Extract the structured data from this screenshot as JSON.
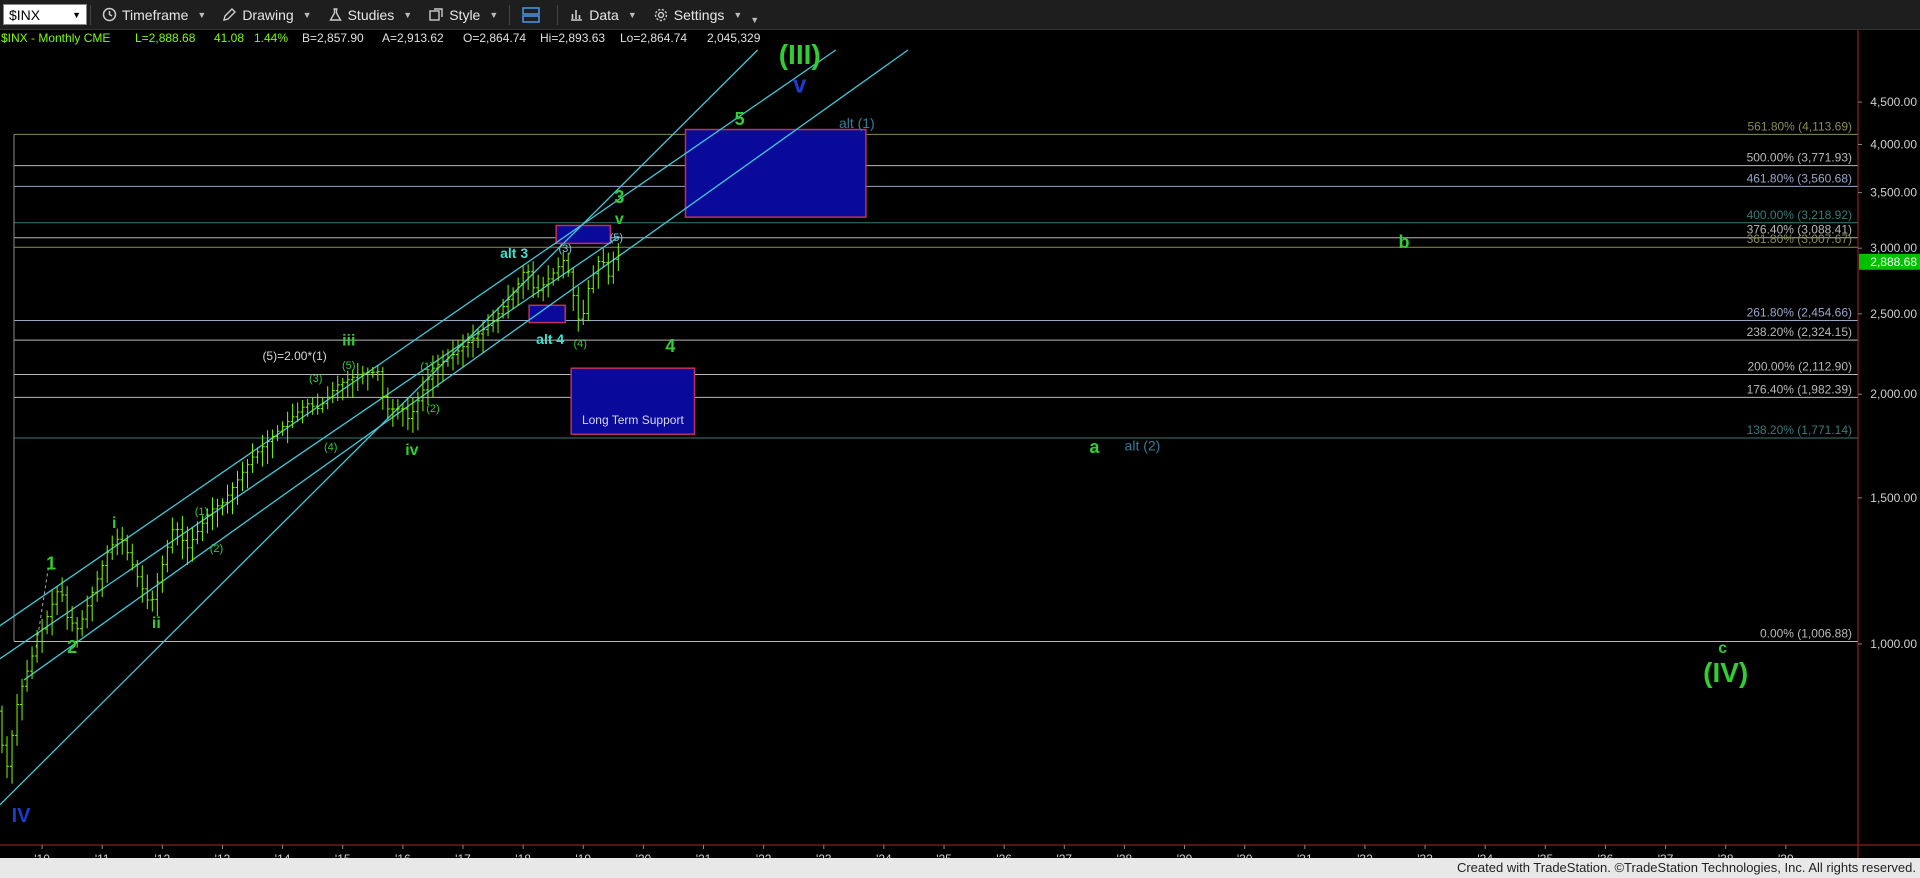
{
  "toolbar": {
    "symbol": "$INX",
    "timeframe_label": "Timeframe",
    "drawing_label": "Drawing",
    "studies_label": "Studies",
    "style_label": "Style",
    "data_label": "Data",
    "settings_label": "Settings"
  },
  "header": {
    "symbol_info": "$INX - Monthly  CME",
    "last": "L=2,888.68",
    "change": "41.08",
    "change_pct": "1.44%",
    "bid": "B=2,857.90",
    "ask": "A=2,913.62",
    "open": "O=2,864.74",
    "high": "Hi=2,893.63",
    "low": "Lo=2,864.74",
    "volume": "2,045,329"
  },
  "footer_text": "Created with TradeStation. ©TradeStation Technologies, Inc. All rights reserved.",
  "colors": {
    "background": "#000000",
    "price_bars": "#7CFC00",
    "wave_green": "#32CD32",
    "wave_cyan": "#40E0D0",
    "wave_blue": "#1E3AD0",
    "channel": "#40C8D8",
    "box_fill": "#0A0A9A",
    "box_border": "#C0305A",
    "last_price_tag": "#00C000"
  },
  "chart_data": {
    "type": "line",
    "scale": "log",
    "x_start": 2009.3,
    "x_end": 2040.2,
    "ylim": [
      600,
      5200
    ],
    "y_ticks": [
      {
        "value": 1000,
        "label": "1,000.00"
      },
      {
        "value": 1500,
        "label": "1,500.00"
      },
      {
        "value": 2000,
        "label": "2,000.00"
      },
      {
        "value": 2500,
        "label": "2,500.00"
      },
      {
        "value": 3000,
        "label": "3,000.00"
      },
      {
        "value": 3500,
        "label": "3,500.00"
      },
      {
        "value": 4000,
        "label": "4,000.00"
      },
      {
        "value": 4500,
        "label": "4,500.00"
      }
    ],
    "x_ticks": [
      {
        "value": 2010,
        "label": "'10"
      },
      {
        "value": 2011,
        "label": "'11"
      },
      {
        "value": 2012,
        "label": "'12"
      },
      {
        "value": 2013,
        "label": "'13"
      },
      {
        "value": 2014,
        "label": "'14"
      },
      {
        "value": 2015,
        "label": "'15"
      },
      {
        "value": 2016,
        "label": "'16"
      },
      {
        "value": 2017,
        "label": "'17"
      },
      {
        "value": 2018,
        "label": "'18"
      },
      {
        "value": 2019,
        "label": "'19"
      },
      {
        "value": 2020,
        "label": "'20"
      },
      {
        "value": 2021,
        "label": "'21"
      },
      {
        "value": 2022,
        "label": "'22"
      },
      {
        "value": 2023,
        "label": "'23"
      },
      {
        "value": 2024,
        "label": "'24"
      },
      {
        "value": 2025,
        "label": "'25"
      },
      {
        "value": 2026,
        "label": "'26"
      },
      {
        "value": 2027,
        "label": "'27"
      },
      {
        "value": 2028,
        "label": "'28"
      },
      {
        "value": 2029,
        "label": "'29"
      },
      {
        "value": 2030,
        "label": "'30"
      },
      {
        "value": 2031,
        "label": "'31"
      },
      {
        "value": 2032,
        "label": "'32"
      },
      {
        "value": 2033,
        "label": "'33"
      },
      {
        "value": 2034,
        "label": "'34"
      },
      {
        "value": 2035,
        "label": "'35"
      },
      {
        "value": 2036,
        "label": "'36"
      },
      {
        "value": 2037,
        "label": "'37"
      },
      {
        "value": 2038,
        "label": "'38"
      },
      {
        "value": 2039,
        "label": "'39"
      }
    ],
    "last_price": {
      "value": 2888.68,
      "label": "2,888.68"
    },
    "price_path": [
      [
        2009.25,
        830
      ],
      [
        2009.4,
        700
      ],
      [
        2009.6,
        860
      ],
      [
        2009.9,
        1000
      ],
      [
        2010.3,
        1180
      ],
      [
        2010.4,
        1080
      ],
      [
        2010.6,
        1040
      ],
      [
        2011.1,
        1300
      ],
      [
        2011.3,
        1350
      ],
      [
        2011.7,
        1150
      ],
      [
        2011.8,
        1110
      ],
      [
        2012.2,
        1400
      ],
      [
        2012.4,
        1300
      ],
      [
        2012.8,
        1450
      ],
      [
        2013.0,
        1480
      ],
      [
        2013.5,
        1680
      ],
      [
        2013.9,
        1800
      ],
      [
        2014.4,
        1950
      ],
      [
        2014.6,
        1920
      ],
      [
        2014.9,
        2050
      ],
      [
        2015.3,
        2120
      ],
      [
        2015.6,
        2130
      ],
      [
        2015.7,
        1920
      ],
      [
        2016.0,
        1920
      ],
      [
        2016.1,
        1860
      ],
      [
        2016.5,
        2150
      ],
      [
        2016.9,
        2250
      ],
      [
        2017.5,
        2450
      ],
      [
        2017.9,
        2700
      ],
      [
        2018.05,
        2860
      ],
      [
        2018.2,
        2640
      ],
      [
        2018.5,
        2800
      ],
      [
        2018.7,
        2920
      ],
      [
        2018.95,
        2400
      ],
      [
        2019.1,
        2720
      ],
      [
        2019.3,
        2950
      ],
      [
        2019.4,
        2750
      ],
      [
        2019.55,
        2990
      ],
      [
        2019.62,
        2890
      ]
    ],
    "fib_levels": [
      {
        "value": 4113.69,
        "label": "561.80% (4,113.69)",
        "color": "#8C8C50"
      },
      {
        "value": 3771.93,
        "label": "500.00% (3,771.93)",
        "color": "#B8B8B8"
      },
      {
        "value": 3560.68,
        "label": "461.80% (3,560.68)",
        "color": "#9AA6C8"
      },
      {
        "value": 3218.92,
        "label": "400.00% (3,218.92)",
        "color": "#3A7A7A"
      },
      {
        "value": 3088.41,
        "label": "376.40% (3,088.41)",
        "color": "#B8B8B8"
      },
      {
        "value": 3007.67,
        "label": "361.80% (3,007.67)",
        "color": "#8C8C50"
      },
      {
        "value": 2454.66,
        "label": "261.80% (2,454.66)",
        "color": "#9AA6C8"
      },
      {
        "value": 2324.15,
        "label": "238.20% (2,324.15)",
        "color": "#B8B8B8"
      },
      {
        "value": 2112.9,
        "label": "200.00% (2,112.90)",
        "color": "#B8B8B8"
      },
      {
        "value": 1982.39,
        "label": "176.40% (1,982.39)",
        "color": "#B8B8B8"
      },
      {
        "value": 1771.14,
        "label": "138.20% (1,771.14)",
        "color": "#3A7A7A"
      },
      {
        "value": 1006.88,
        "label": "0.00% (1,006.88)",
        "color": "#B8B8B8"
      }
    ],
    "channels": [
      {
        "x1": 2009.3,
        "y1": 640,
        "x2": 2021.9,
        "y2": 5200
      },
      {
        "x1": 2009.3,
        "y1": 960,
        "x2": 2019.6,
        "y2": 3100
      },
      {
        "x1": 2009.2,
        "y1": 1040,
        "x2": 2023.2,
        "y2": 5200
      },
      {
        "x1": 2009.7,
        "y1": 905,
        "x2": 2024.4,
        "y2": 5200
      }
    ],
    "boxes": [
      {
        "x1": 2020.7,
        "x2": 2023.7,
        "y1": 3270,
        "y2": 4170,
        "label": ""
      },
      {
        "x1": 2018.8,
        "x2": 2020.85,
        "y1": 1790,
        "y2": 2150,
        "label": "Long Term Support"
      },
      {
        "x1": 2018.55,
        "x2": 2019.45,
        "y1": 3040,
        "y2": 3195,
        "label": ""
      },
      {
        "x1": 2018.1,
        "x2": 2018.7,
        "y1": 2440,
        "y2": 2560,
        "label": ""
      }
    ],
    "annotations": [
      {
        "text": "(III)",
        "x": 2022.6,
        "y": 5000,
        "color": "wave_green",
        "size": 28,
        "weight": "bold"
      },
      {
        "text": "v",
        "x": 2022.6,
        "y": 4620,
        "color": "wave_blue",
        "size": 24,
        "weight": "bold"
      },
      {
        "text": "5",
        "x": 2021.6,
        "y": 4220,
        "color": "wave_green",
        "size": 18,
        "weight": "bold"
      },
      {
        "text": "alt (1)",
        "x": 2023.55,
        "y": 4190,
        "color": "#3A7A9A",
        "size": 14,
        "weight": "normal"
      },
      {
        "text": "3",
        "x": 2019.6,
        "y": 3400,
        "color": "wave_green",
        "size": 18,
        "weight": "bold"
      },
      {
        "text": "v",
        "x": 2019.6,
        "y": 3210,
        "color": "wave_green",
        "size": 16,
        "weight": "bold"
      },
      {
        "text": "(5)",
        "x": 2019.55,
        "y": 3060,
        "color": "#80C8E8",
        "size": 11,
        "weight": "normal"
      },
      {
        "text": "(3)",
        "x": 2018.7,
        "y": 2970,
        "color": "#80C8E8",
        "size": 11,
        "weight": "normal"
      },
      {
        "text": "alt 3",
        "x": 2017.85,
        "y": 2920,
        "color": "wave_cyan",
        "size": 14,
        "weight": "bold"
      },
      {
        "text": "alt 4",
        "x": 2018.45,
        "y": 2300,
        "color": "wave_cyan",
        "size": 14,
        "weight": "bold"
      },
      {
        "text": "(4)",
        "x": 2018.95,
        "y": 2280,
        "color": "wave_green",
        "size": 11,
        "weight": "normal"
      },
      {
        "text": "4",
        "x": 2020.45,
        "y": 2250,
        "color": "wave_green",
        "size": 18,
        "weight": "bold"
      },
      {
        "text": "b",
        "x": 2032.65,
        "y": 3000,
        "color": "wave_green",
        "size": 18,
        "weight": "bold"
      },
      {
        "text": "a",
        "x": 2027.5,
        "y": 1700,
        "color": "wave_green",
        "size": 18,
        "weight": "bold"
      },
      {
        "text": "alt (2)",
        "x": 2028.3,
        "y": 1710,
        "color": "#3A7A9A",
        "size": 14,
        "weight": "normal"
      },
      {
        "text": "iii",
        "x": 2015.1,
        "y": 2290,
        "color": "wave_green",
        "size": 16,
        "weight": "bold"
      },
      {
        "text": "(5)=2.00*(1)",
        "x": 2014.2,
        "y": 2200,
        "color": "#D8D8D8",
        "size": 12,
        "weight": "normal"
      },
      {
        "text": "(5)",
        "x": 2015.1,
        "y": 2145,
        "color": "wave_green",
        "size": 11,
        "weight": "normal"
      },
      {
        "text": "(3)",
        "x": 2014.55,
        "y": 2070,
        "color": "wave_green",
        "size": 11,
        "weight": "normal"
      },
      {
        "text": "(1)",
        "x": 2016.4,
        "y": 2140,
        "color": "wave_green",
        "size": 11,
        "weight": "normal"
      },
      {
        "text": "(2)",
        "x": 2016.5,
        "y": 1905,
        "color": "wave_green",
        "size": 11,
        "weight": "normal"
      },
      {
        "text": "(4)",
        "x": 2014.8,
        "y": 1710,
        "color": "wave_green",
        "size": 11,
        "weight": "normal"
      },
      {
        "text": "iv",
        "x": 2016.15,
        "y": 1690,
        "color": "wave_green",
        "size": 16,
        "weight": "bold"
      },
      {
        "text": "(1)",
        "x": 2012.65,
        "y": 1430,
        "color": "wave_green",
        "size": 11,
        "weight": "normal"
      },
      {
        "text": "(2)",
        "x": 2012.9,
        "y": 1290,
        "color": "wave_green",
        "size": 11,
        "weight": "normal"
      },
      {
        "text": "i",
        "x": 2011.2,
        "y": 1380,
        "color": "wave_green",
        "size": 16,
        "weight": "bold"
      },
      {
        "text": "ii",
        "x": 2011.9,
        "y": 1045,
        "color": "wave_green",
        "size": 16,
        "weight": "bold"
      },
      {
        "text": "1",
        "x": 2010.15,
        "y": 1230,
        "color": "wave_green",
        "size": 18,
        "weight": "bold"
      },
      {
        "text": "2",
        "x": 2010.5,
        "y": 975,
        "color": "wave_green",
        "size": 18,
        "weight": "bold"
      },
      {
        "text": "IV",
        "x": 2009.65,
        "y": 610,
        "color": "wave_blue",
        "size": 20,
        "weight": "bold"
      },
      {
        "text": "c",
        "x": 2037.95,
        "y": 975,
        "color": "wave_green",
        "size": 16,
        "weight": "bold"
      },
      {
        "text": "(IV)",
        "x": 2038.0,
        "y": 900,
        "color": "wave_green",
        "size": 28,
        "weight": "bold"
      }
    ]
  }
}
